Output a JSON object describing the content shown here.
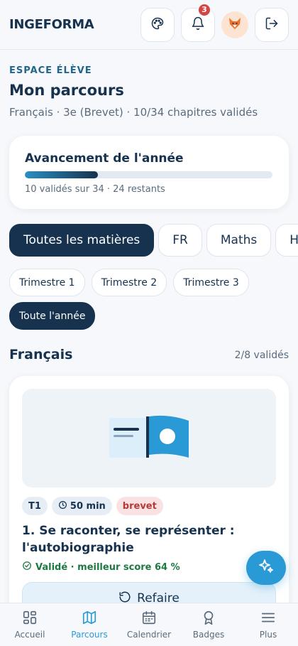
{
  "app": {
    "brand": "INGEFORMA"
  },
  "header": {
    "notification_count": "3"
  },
  "page": {
    "eyebrow": "ESPACE ÉLÈVE",
    "title": "Mon parcours",
    "subtitle": "Français · 3e (Brevet) · 10/34 chapitres validés"
  },
  "progress": {
    "title": "Avancement de l'année",
    "validated": 10,
    "total": 34,
    "fraction": 0.294,
    "caption": "10 validés sur 34 · 24 restants"
  },
  "subject_chips": [
    {
      "label": "Toutes les matières",
      "active": true
    },
    {
      "label": "FR",
      "active": false
    },
    {
      "label": "Maths",
      "active": false
    },
    {
      "label": "HG",
      "active": false
    }
  ],
  "terms": [
    {
      "label": "Trimestre 1"
    },
    {
      "label": "Trimestre 2"
    },
    {
      "label": "Trimestre 3"
    },
    {
      "label": "Toute l'année",
      "active": true
    }
  ],
  "section": {
    "title": "Français",
    "count": "2/8 validés"
  },
  "course": {
    "tags": {
      "term": "T1",
      "duration": "50 min",
      "exam": "brevet"
    },
    "title": "1. Se raconter, se représenter : l'autobiographie",
    "status": "Validé · meilleur score 64 %",
    "action_label": "Refaire"
  },
  "bottom_nav": [
    {
      "label": "Accueil",
      "icon": "grid-icon"
    },
    {
      "label": "Parcours",
      "icon": "map-icon",
      "active": true
    },
    {
      "label": "Calendrier",
      "icon": "calendar-icon"
    },
    {
      "label": "Badges",
      "icon": "award-icon"
    },
    {
      "label": "Plus",
      "icon": "menu-icon"
    }
  ],
  "colors": {
    "navy": "#16324f",
    "accent": "#2a9ad6",
    "success": "#1d7a43",
    "danger": "#d64545"
  }
}
